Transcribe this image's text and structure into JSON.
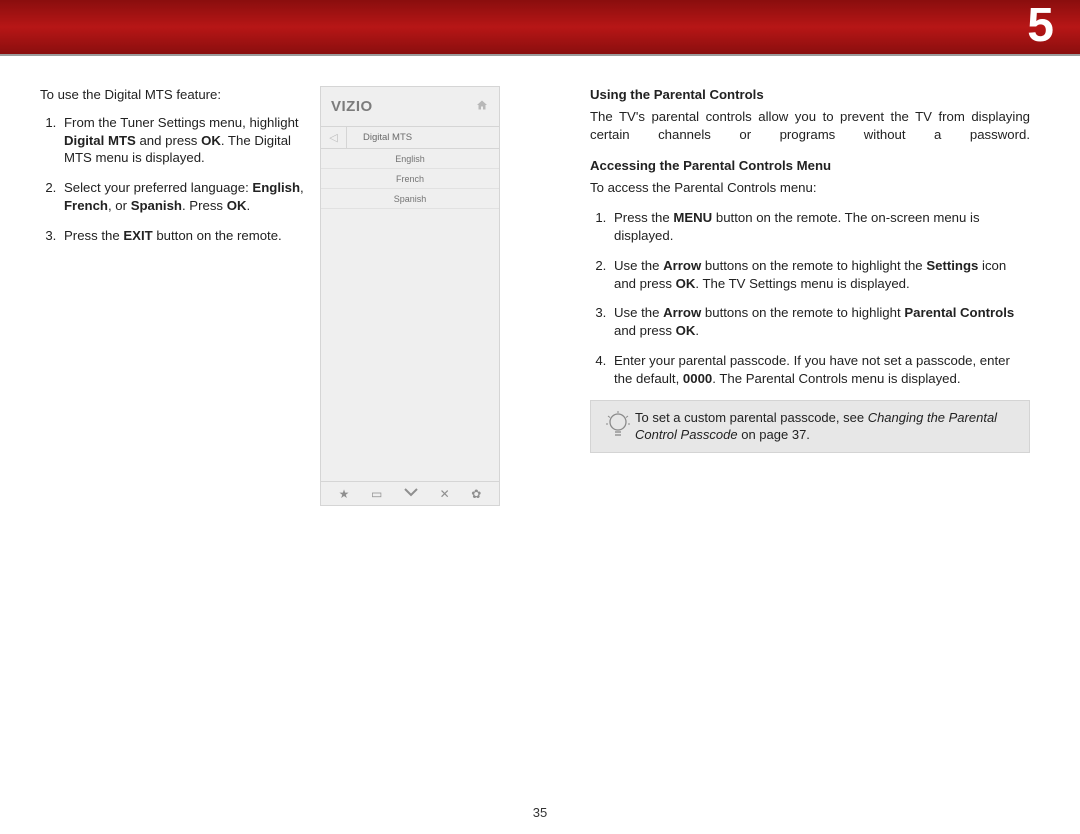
{
  "chapter_number": "5",
  "page_number": "35",
  "left": {
    "intro": "To use the Digital MTS feature:",
    "steps": [
      {
        "pre": "From the Tuner Settings menu, highlight ",
        "b1": "Digital MTS",
        "mid1": " and press ",
        "b2": "OK",
        "post": ". The Digital MTS menu is displayed."
      },
      {
        "pre": "Select your preferred language: ",
        "b1": "English",
        "mid1": ", ",
        "b2": "French",
        "mid2": ", or ",
        "b3": "Spanish",
        "mid3": ". Press ",
        "b4": "OK",
        "post": "."
      },
      {
        "pre": "Press the ",
        "b1": "EXIT",
        "post": " button on the remote."
      }
    ]
  },
  "tv": {
    "brand": "VIZIO",
    "menu_title": "Digital MTS",
    "options": [
      "English",
      "French",
      "Spanish"
    ]
  },
  "right": {
    "h1": "Using the Parental Controls",
    "p1": "The TV's parental controls allow you to prevent the TV from displaying certain channels or programs without a password.",
    "h2": "Accessing the Parental Controls Menu",
    "p2": "To access the Parental Controls menu:",
    "steps": [
      {
        "pre": "Press the ",
        "b1": "MENU",
        "post": " button on the remote. The on-screen menu is displayed."
      },
      {
        "pre": "Use the ",
        "b1": "Arrow",
        "mid1": " buttons on the remote to highlight the ",
        "b2": "Settings",
        "mid2": " icon and press ",
        "b3": "OK",
        "post": ". The TV Settings menu is displayed."
      },
      {
        "pre": "Use the ",
        "b1": "Arrow",
        "mid1": " buttons on the remote to highlight ",
        "b2": "Parental Controls",
        "mid2": " and press ",
        "b3": "OK",
        "post": "."
      },
      {
        "pre": "Enter your parental passcode. If you have not set a passcode, enter the default, ",
        "b1": "0000",
        "post": ". The Parental Controls menu is displayed."
      }
    ],
    "tip_pre": "To set a custom parental passcode, see ",
    "tip_em": "Changing the Parental Control Passcode",
    "tip_post": " on page 37."
  }
}
